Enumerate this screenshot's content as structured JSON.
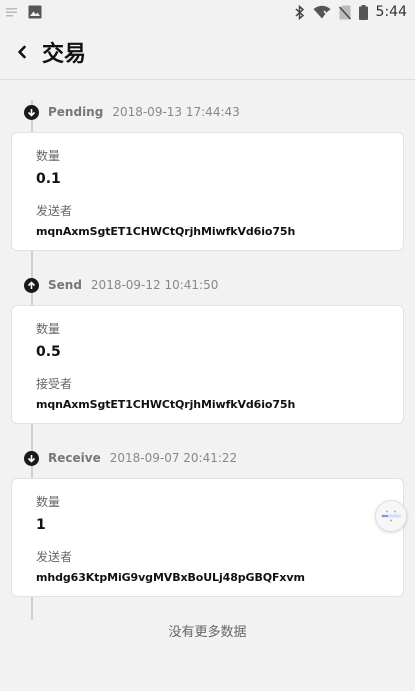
{
  "statusbar": {
    "time": "5:44",
    "icons": [
      "signal-icon",
      "image-icon",
      "bluetooth-icon",
      "wifi-icon",
      "sim-icon",
      "battery-icon"
    ]
  },
  "header": {
    "title": "交易",
    "back_icon": "chevron-left-icon"
  },
  "transactions": [
    {
      "direction_icon": "arrow-down-circle-icon",
      "type": "Pending",
      "time": "2018-09-13 17:44:43",
      "amount_label": "数量",
      "amount": "0.1",
      "party_label": "发送者",
      "address": "mqnAxmSgtET1CHWCtQrjhMiwfkVd6io75h"
    },
    {
      "direction_icon": "arrow-up-circle-icon",
      "type": "Send",
      "time": "2018-09-12 10:41:50",
      "amount_label": "数量",
      "amount": "0.5",
      "party_label": "接受者",
      "address": "mqnAxmSgtET1CHWCtQrjhMiwfkVd6io75h"
    },
    {
      "direction_icon": "arrow-down-circle-icon",
      "type": "Receive",
      "time": "2018-09-07 20:41:22",
      "amount_label": "数量",
      "amount": "1",
      "party_label": "发送者",
      "address": "mhdg63KtpMiG9vgMVBxBoULj48pGBQFxvm"
    }
  ],
  "footer": {
    "no_more_text": "没有更多数据"
  },
  "colors": {
    "background": "#f2f2f2",
    "card": "#ffffff",
    "accent_dark": "#1a1a1a"
  }
}
